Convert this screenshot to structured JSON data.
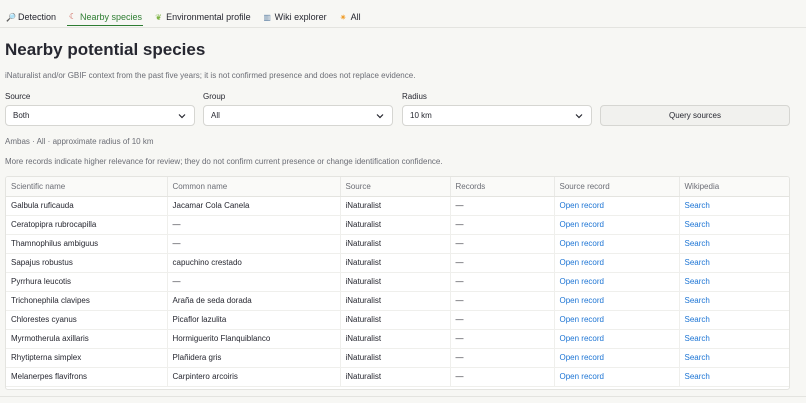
{
  "tabs": [
    {
      "label": "Detection",
      "icon": "magnifier-icon",
      "glyph": "🔎",
      "color": "#3b6fb6"
    },
    {
      "label": "Nearby species",
      "icon": "moon-icon",
      "glyph": "☾",
      "color": "#c0392b",
      "active": true
    },
    {
      "label": "Environmental profile",
      "icon": "leaf-icon",
      "glyph": "❦",
      "color": "#7cb342"
    },
    {
      "label": "Wiki explorer",
      "icon": "books-icon",
      "glyph": "▥",
      "color": "#5c7fa3"
    },
    {
      "label": "All",
      "icon": "sparkle-icon",
      "glyph": "✷",
      "color": "#f0a030"
    }
  ],
  "page": {
    "title": "Nearby potential species",
    "subtitle": "iNaturalist and/or GBIF context from the past five years; it is not confirmed presence and does not replace evidence."
  },
  "filters": {
    "source": {
      "label": "Source",
      "value": "Both"
    },
    "group": {
      "label": "Group",
      "value": "All"
    },
    "radius": {
      "label": "Radius",
      "value": "10 km"
    },
    "query_label": "Query sources"
  },
  "summary": "Ambas · All · approximate radius of 10 km",
  "note": "More records indicate higher relevance for review; they do not confirm current presence or change identification confidence.",
  "table": {
    "headers": [
      "Scientific name",
      "Common name",
      "Source",
      "Records",
      "Source record",
      "Wikipedia"
    ],
    "rows": [
      [
        "Galbula ruficauda",
        "Jacamar Cola Canela",
        "iNaturalist",
        "—",
        "Open record",
        "Search"
      ],
      [
        "Ceratopipra rubrocapilla",
        "—",
        "iNaturalist",
        "—",
        "Open record",
        "Search"
      ],
      [
        "Thamnophilus ambiguus",
        "—",
        "iNaturalist",
        "—",
        "Open record",
        "Search"
      ],
      [
        "Sapajus robustus",
        "capuchino crestado",
        "iNaturalist",
        "—",
        "Open record",
        "Search"
      ],
      [
        "Pyrrhura leucotis",
        "—",
        "iNaturalist",
        "—",
        "Open record",
        "Search"
      ],
      [
        "Trichonephila clavipes",
        "Araña de seda dorada",
        "iNaturalist",
        "—",
        "Open record",
        "Search"
      ],
      [
        "Chlorestes cyanus",
        "Picaflor lazulita",
        "iNaturalist",
        "—",
        "Open record",
        "Search"
      ],
      [
        "Myrmotherula axillaris",
        "Hormiguerito Flanquiblanco",
        "iNaturalist",
        "—",
        "Open record",
        "Search"
      ],
      [
        "Rhytipterna simplex",
        "Plañidera gris",
        "iNaturalist",
        "—",
        "Open record",
        "Search"
      ],
      [
        "Melanerpes flavifrons",
        "Carpintero arcoiris",
        "iNaturalist",
        "—",
        "Open record",
        "Search"
      ]
    ]
  },
  "colors": {
    "accent": "#2e7d32",
    "link": "#1c74d4"
  }
}
